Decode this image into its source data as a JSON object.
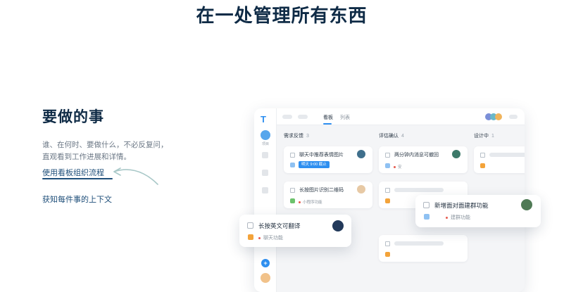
{
  "hero": {
    "title": "在一处管理所有东西"
  },
  "left": {
    "heading": "要做的事",
    "desc_line1": "谁、在何时、要做什么，不必反复问，",
    "desc_line2": "直观看到工作进展和详情。",
    "link1": "使用看板组织流程",
    "link2": "获知每件事的上下文"
  },
  "app": {
    "sidebar": {
      "project_label": "项目"
    },
    "tabs": [
      {
        "label": "看板",
        "active": true
      },
      {
        "label": "列表",
        "active": false
      }
    ],
    "columns": [
      {
        "name": "需求反馈",
        "count": "3"
      },
      {
        "name": "评估确认",
        "count": "4"
      },
      {
        "name": "设计中",
        "count": "1"
      }
    ],
    "cards": {
      "c1": {
        "title": "聊天中推荐表情图片",
        "due": "明天 9:00 截止"
      },
      "c2": {
        "title": "长按图片识别二维码",
        "tag": "小程序功能"
      },
      "c3": {
        "title": "两分钟内消息可撤回",
        "tag": "安"
      }
    },
    "floats": {
      "f1": {
        "title": "长按英文可翻译",
        "tag": "聊天功能"
      },
      "f2": {
        "title": "新增面对面建群功能",
        "tag": "建群功能"
      }
    },
    "colors": {
      "accent": "#2e8ff0",
      "tag_orange": "#f3a33a",
      "tag_green": "#6cc26c",
      "tag_red": "#e65b4f"
    }
  }
}
